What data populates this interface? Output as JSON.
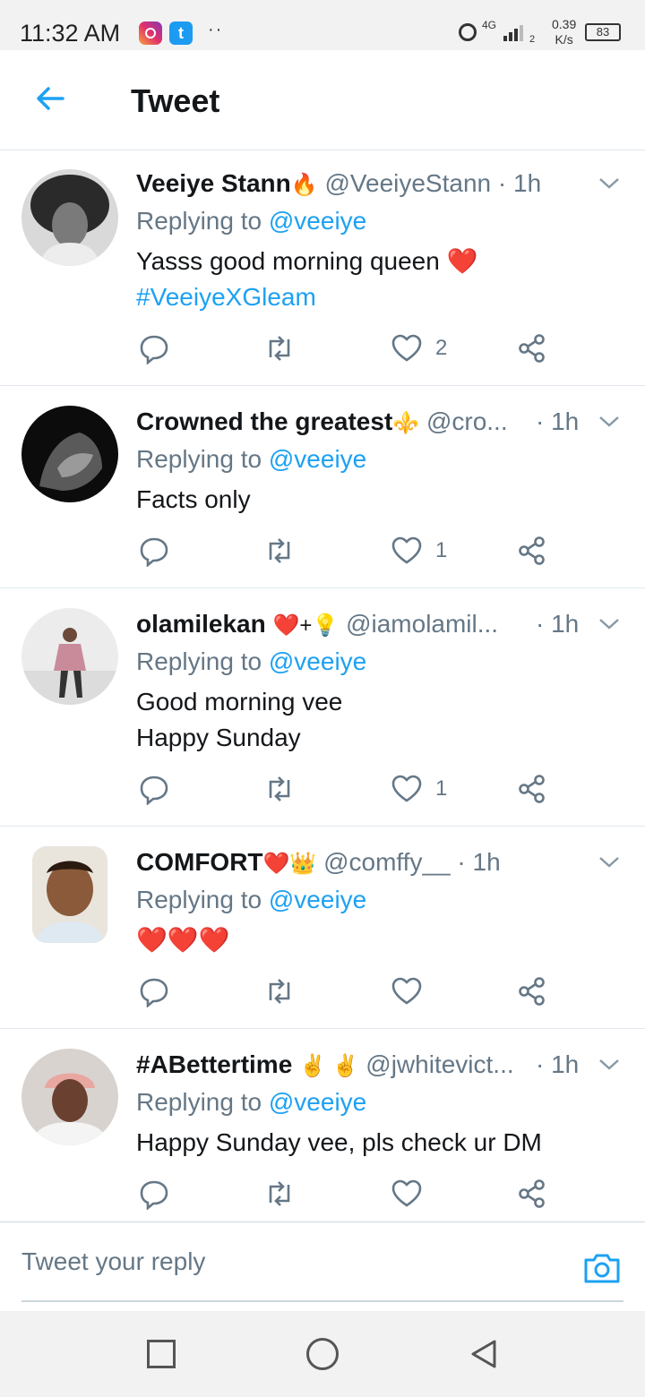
{
  "status_bar": {
    "time": "11:32 AM",
    "dots": "··",
    "network": "4G",
    "sim": "2",
    "speed_value": "0.39",
    "speed_unit": "K/s",
    "battery": "83"
  },
  "header": {
    "title": "Tweet"
  },
  "tweets": [
    {
      "name": "Veeiye Stann",
      "name_emoji": "🔥",
      "handle": "@VeeiyeStann",
      "time": "· 1h",
      "replying_label": "Replying to",
      "replying_handle": "@veeiye",
      "text_lines": [
        "Yasss good morning queen ❤️"
      ],
      "hashtag": "#VeeiyeXGleam",
      "likes": "2"
    },
    {
      "name": "Crowned the greatest",
      "name_emoji": "⚜️",
      "handle": "@cro...",
      "time": "· 1h",
      "replying_label": "Replying to",
      "replying_handle": "@veeiye",
      "text_lines": [
        "Facts only"
      ],
      "likes": "1"
    },
    {
      "name": "olamilekan",
      "name_emoji": "❤️+💡",
      "handle": "@iamolamil...",
      "time": "· 1h",
      "replying_label": "Replying to",
      "replying_handle": "@veeiye",
      "text_lines": [
        "Good morning vee",
        "Happy Sunday"
      ],
      "likes": "1"
    },
    {
      "name": "COMFORT",
      "name_emoji": "❤️👑",
      "handle": "@comffy__",
      "time": "· 1h",
      "replying_label": "Replying to",
      "replying_handle": "@veeiye",
      "text_lines": [
        "❤️❤️❤️"
      ],
      "likes": ""
    },
    {
      "name": "#ABettertime",
      "name_emoji": "✌️ ✌️",
      "handle": "@jwhitevict...",
      "time": "· 1h",
      "replying_label": "Replying to",
      "replying_handle": "@veeiye",
      "text_lines": [
        "Happy Sunday vee, pls check ur DM"
      ],
      "likes": ""
    }
  ],
  "reply_bar": {
    "placeholder": "Tweet your reply"
  },
  "colors": {
    "accent": "#1da1f2",
    "muted": "#657786",
    "text": "#14171a"
  }
}
